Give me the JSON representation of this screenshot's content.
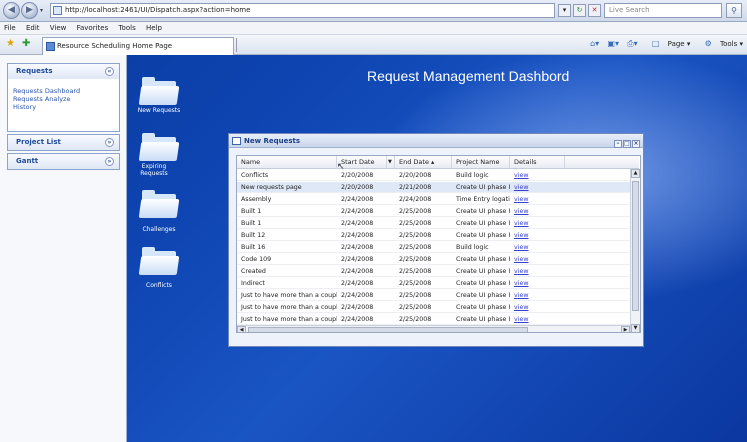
{
  "browser": {
    "url": "http://localhost:2461/UI/Dispatch.aspx?action=home",
    "search_placeholder": "Live Search",
    "tab_title": "Resource Scheduling Home Page",
    "menu": [
      "File",
      "Edit",
      "View",
      "Favorites",
      "Tools",
      "Help"
    ],
    "toolbar_right": {
      "page_label": "Page",
      "tools_label": "Tools"
    }
  },
  "sidebar": {
    "sections": [
      {
        "title": "Requests",
        "toggle": "«",
        "links": [
          "Requests Dashboard",
          "Requests Analyze",
          "History"
        ]
      },
      {
        "title": "Project List",
        "toggle": "»"
      },
      {
        "title": "Gantt",
        "toggle": "»"
      }
    ]
  },
  "dashboard": {
    "title": "Request Management Dashbord",
    "folders": [
      "New Requests",
      "Expiring Requests",
      "Challenges",
      "Conflicts"
    ]
  },
  "dialog": {
    "title": "New Requests",
    "columns": [
      "Name",
      "Start Date",
      "End Date ▴",
      "Project Name",
      "Details"
    ],
    "selected_row_index": 1,
    "rows": [
      {
        "name": "Conflicts",
        "start": "2/20/2008",
        "end": "2/20/2008",
        "project": "Build logic",
        "details": "view"
      },
      {
        "name": "New requests page",
        "start": "2/20/2008",
        "end": "2/21/2008",
        "project": "Create UI phase I...",
        "details": "view"
      },
      {
        "name": "Assembly",
        "start": "2/24/2008",
        "end": "2/24/2008",
        "project": "Time Entry logati...",
        "details": "view"
      },
      {
        "name": "Built 1",
        "start": "2/24/2008",
        "end": "2/25/2008",
        "project": "Create UI phase I...",
        "details": "view"
      },
      {
        "name": "Built 1",
        "start": "2/24/2008",
        "end": "2/25/2008",
        "project": "Create UI phase I...",
        "details": "view"
      },
      {
        "name": "Built 12",
        "start": "2/24/2008",
        "end": "2/25/2008",
        "project": "Create UI phase I...",
        "details": "view"
      },
      {
        "name": "Built 16",
        "start": "2/24/2008",
        "end": "2/25/2008",
        "project": "Build logic",
        "details": "view"
      },
      {
        "name": "Code 109",
        "start": "2/24/2008",
        "end": "2/25/2008",
        "project": "Create UI phase I...",
        "details": "view"
      },
      {
        "name": "Created",
        "start": "2/24/2008",
        "end": "2/25/2008",
        "project": "Create UI phase I...",
        "details": "view"
      },
      {
        "name": "Indirect",
        "start": "2/24/2008",
        "end": "2/25/2008",
        "project": "Create UI phase I...",
        "details": "view"
      },
      {
        "name": "Just to have more than a coupl...",
        "start": "2/24/2008",
        "end": "2/25/2008",
        "project": "Create UI phase I...",
        "details": "view"
      },
      {
        "name": "Just to have more than a coupl...",
        "start": "2/24/2008",
        "end": "2/25/2008",
        "project": "Create UI phase I...",
        "details": "view"
      },
      {
        "name": "Just to have more than a coupl...",
        "start": "2/24/2008",
        "end": "2/25/2008",
        "project": "Create UI phase I...",
        "details": "view"
      }
    ]
  }
}
